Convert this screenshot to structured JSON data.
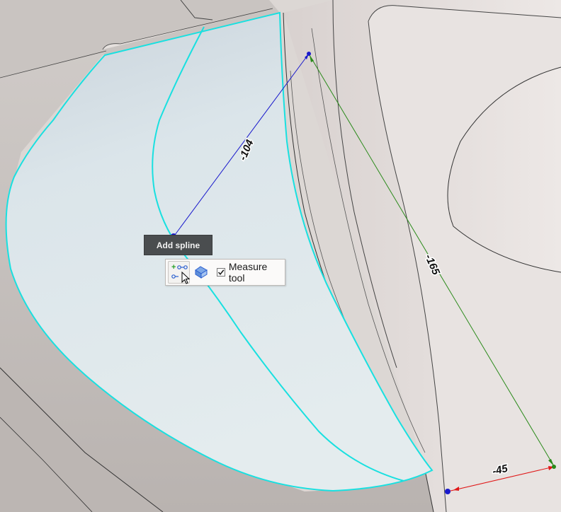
{
  "tooltip": {
    "text": "Add spline"
  },
  "minibar": {
    "measure_label": "Measure tool",
    "measure_checked": true
  },
  "dimensions": [
    {
      "value": "-104",
      "color": "#1a1acc"
    },
    {
      "value": "-165",
      "color": "#2a8a1a"
    },
    {
      "value": "-45",
      "color": "#e01818"
    }
  ],
  "colors": {
    "surface_edge": "#19e0e0",
    "selected_face": "#dde7ea",
    "background": "#d9d4d1"
  }
}
